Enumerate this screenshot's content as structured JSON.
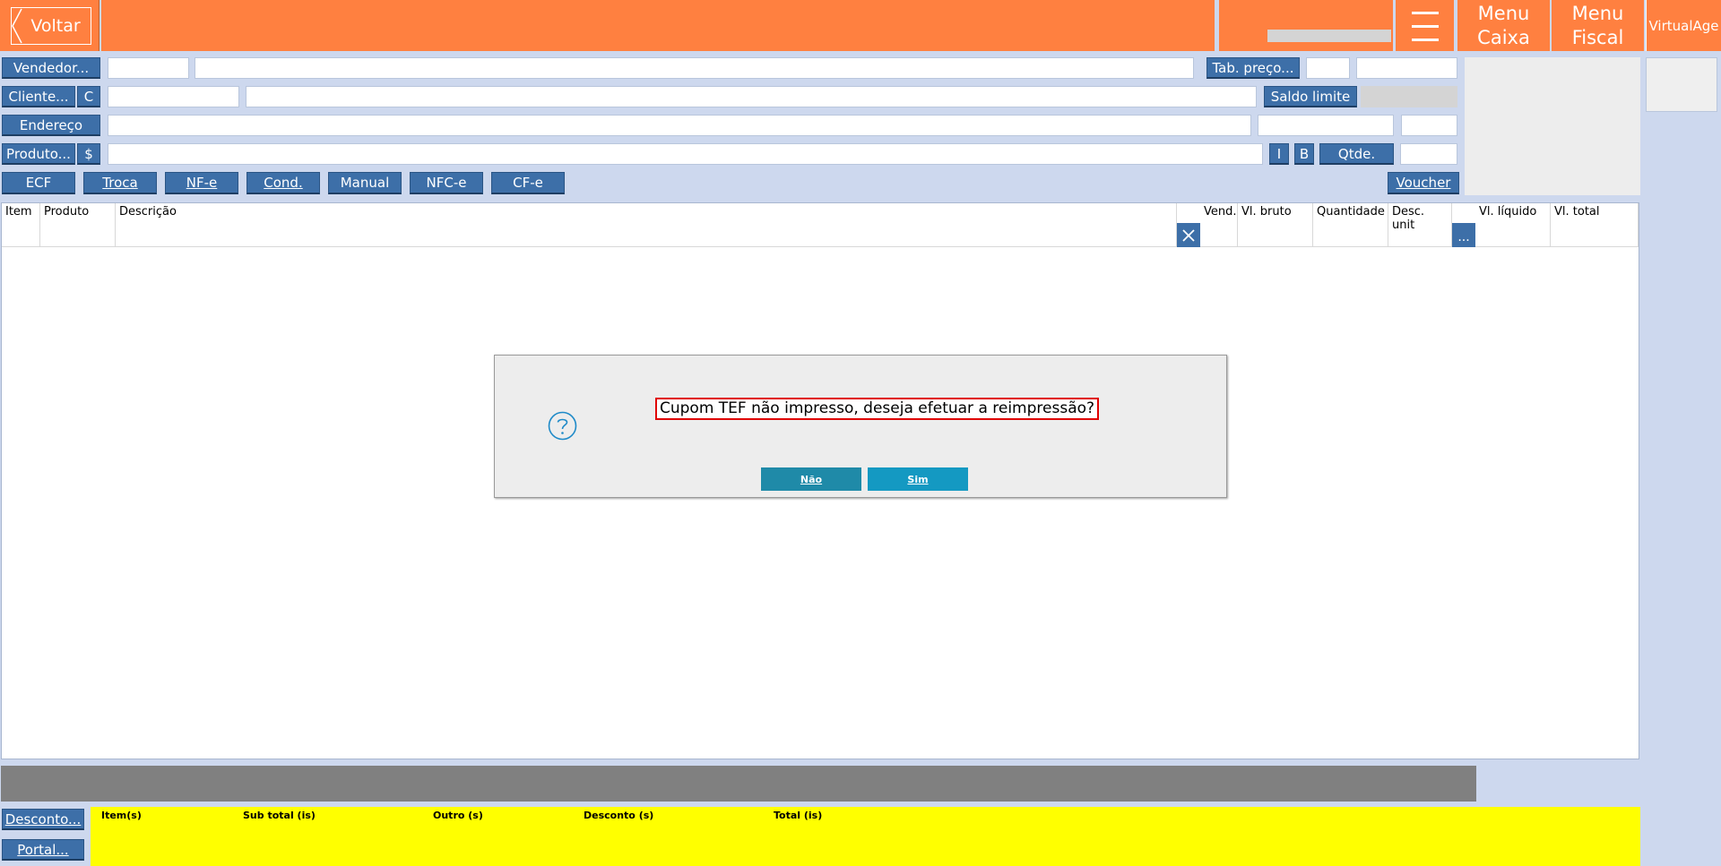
{
  "header": {
    "back_label": "Voltar",
    "menu_caixa_line1": "Menu",
    "menu_caixa_line2": "Caixa",
    "menu_fiscal_line1": "Menu",
    "menu_fiscal_line2": "Fiscal",
    "brand": "VirtualAge"
  },
  "form": {
    "vendedor_label": "Vendedor...",
    "tab_preco_label": "Tab. preço...",
    "cliente_label": "Cliente...",
    "cliente_c_label": "C",
    "saldo_limite_label": "Saldo limite",
    "endereco_label": "Endereço",
    "produto_label": "Produto...",
    "produto_dollar_label": "$",
    "i_label": "I",
    "b_label": "B",
    "qtde_label": "Qtde."
  },
  "doc_buttons": {
    "ecf": "ECF",
    "troca": "Troca",
    "nfe": "NF-e",
    "cond": "Cond.",
    "manual": "Manual",
    "nfce": "NFC-e",
    "cfe": "CF-e",
    "voucher": "Voucher"
  },
  "grid": {
    "columns": [
      "Item",
      "Produto",
      "Descrição",
      "Vend.",
      "Vl. bruto",
      "Quantidade",
      "Desc. unit",
      "Vl. líquido",
      "Vl. total"
    ],
    "dots_label": "..."
  },
  "dialog": {
    "message": "Cupom TEF não impresso, deseja efetuar a reimpressão?",
    "no_label": "Não",
    "yes_label": "Sim"
  },
  "footer": {
    "desconto_label": "Desconto...",
    "portal_label": "Portal...",
    "totals": [
      "Item(s)",
      "Sub total (is)",
      "Outro (s)",
      "Desconto (s)",
      "Total (is)"
    ]
  },
  "colors": {
    "header_orange": "#ff8040",
    "button_blue": "#3d6fa8",
    "totals_yellow": "#ffff00",
    "dialog_no": "#1f8aa8",
    "dialog_yes": "#1499c2"
  }
}
